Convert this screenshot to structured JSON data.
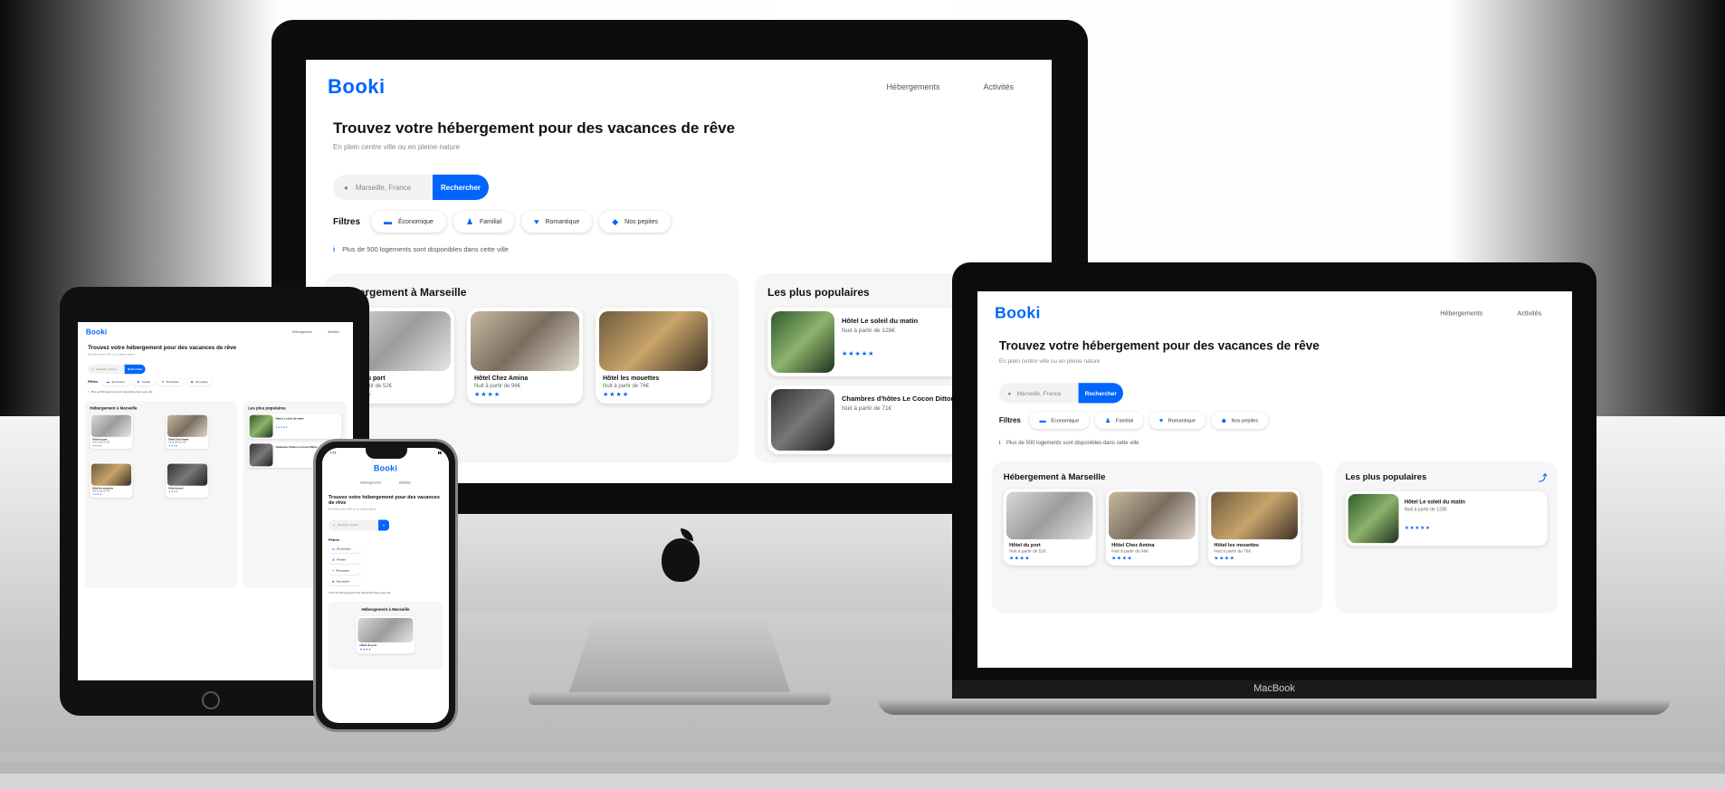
{
  "site": {
    "logo": "Booki",
    "nav": [
      "Hébergements",
      "Activités"
    ],
    "hero_title": "Trouvez votre hébergement pour des vacances de rêve",
    "hero_subtitle": "En plein centre ville ou en pleine nature",
    "search_placeholder": "Marseille, France",
    "search_button": "Rechercher",
    "filters_label": "Filtres",
    "filters": [
      {
        "label": "Économique",
        "icon": "money-icon"
      },
      {
        "label": "Familial",
        "icon": "child-icon"
      },
      {
        "label": "Romantique",
        "icon": "heart-icon"
      },
      {
        "label": "Nos pepites",
        "icon": "gem-icon"
      }
    ],
    "info_text": "Plus de 500 logements sont disponibles dans cette ville",
    "hebergement_title": "Hébergement à Marseille",
    "populaires_title": "Les plus populaires",
    "cards": [
      {
        "name": "Hôtel du port",
        "price": "Nuit à partir de 52€",
        "stars": "★★★★"
      },
      {
        "name": "Hôtel Chez Amina",
        "price": "Nuit à partir de 96€",
        "stars": "★★★★"
      },
      {
        "name": "Hôtel les mouettes",
        "price": "Nuit à partir de 76€",
        "stars": "★★★★"
      }
    ],
    "popular": [
      {
        "name": "Hôtel Le soleil du matin",
        "price": "Nuit à partir de 128€",
        "stars": "★★★★★"
      },
      {
        "name": "Chambres d'hôtes Le Cocon Ditton",
        "price": "Nuit à partir de 71€",
        "stars": "★★★★★"
      }
    ],
    "phone_time": "7:41"
  },
  "devices": {
    "laptop_brand": "MacBook"
  },
  "colors": {
    "accent": "#0065fc"
  }
}
